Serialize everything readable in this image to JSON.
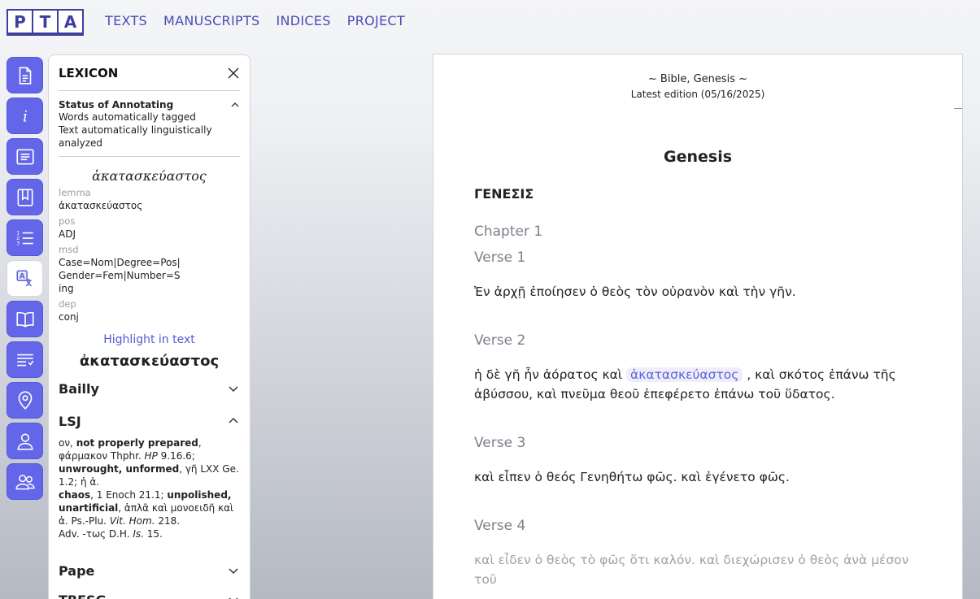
{
  "logo": {
    "letters": [
      "P",
      "T",
      "A"
    ]
  },
  "nav": {
    "items": [
      "TEXTS",
      "MANUSCRIPTS",
      "INDICES",
      "PROJECT"
    ]
  },
  "rail": {
    "icons": [
      "document-icon",
      "info-icon",
      "text-icon",
      "bookmark-icon",
      "numbered-list-icon",
      "translate-icon",
      "book-icon",
      "text-wrap-icon",
      "location-icon",
      "user-icon",
      "group-icon"
    ],
    "active": "translate-icon"
  },
  "lexicon": {
    "title": "LEXICON",
    "status": {
      "title": "Status of Annotating",
      "lines": [
        "Words automatically tagged",
        "Text automatically linguistically analyzed"
      ]
    },
    "lemma_heading": "ἀκατασκεύαστος",
    "fields": [
      {
        "label": "lemma",
        "value": "ἀκατασκεύαστος"
      },
      {
        "label": "pos",
        "value": "ADJ"
      },
      {
        "label": "msd",
        "value": "Case=Nom|Degree=Pos|Gender=Fem|Number=Sing"
      },
      {
        "label": "dep",
        "value": "conj"
      }
    ],
    "highlight_link": "Highlight in text",
    "word": "ἀκατασκεύαστος",
    "dictionaries": [
      "Bailly",
      "LSJ",
      "Pape",
      "TBESG"
    ]
  },
  "document": {
    "edition": "~ Bible, Genesis ~",
    "date": "Latest edition (05/16/2025)",
    "title": "Genesis",
    "book": "ΓΕΝΕΣΙΣ",
    "chapter": "Chapter 1",
    "verses": [
      {
        "label": "Verse 1",
        "text": "Ἐν ἀρχῇ ἐποίησεν ὁ θεὸς τὸν οὐρανὸν καὶ τὴν γῆν."
      },
      {
        "label": "Verse 2",
        "text_before": "ἡ δὲ γῆ ἦν ἀόρατος καὶ ",
        "highlight": "ἀκατασκεύαστος",
        "text_after": " , καὶ σκότος ἐπάνω τῆς ἀβύσσου, καὶ πνεῦμα θεοῦ ἐπεφέρετο ἐπάνω τοῦ ὕδατος."
      },
      {
        "label": "Verse 3",
        "text": "καὶ εἶπεν ὁ θεός Γενηθήτω φῶς. καὶ ἐγένετο φῶς."
      },
      {
        "label": "Verse 4",
        "text": "καὶ εἶδεν ὁ θεὸς τὸ φῶς ὅτι καλόν. καὶ διεχώρισεν ὁ θεὸς ἀνὰ μέσον τοῦ"
      }
    ]
  }
}
